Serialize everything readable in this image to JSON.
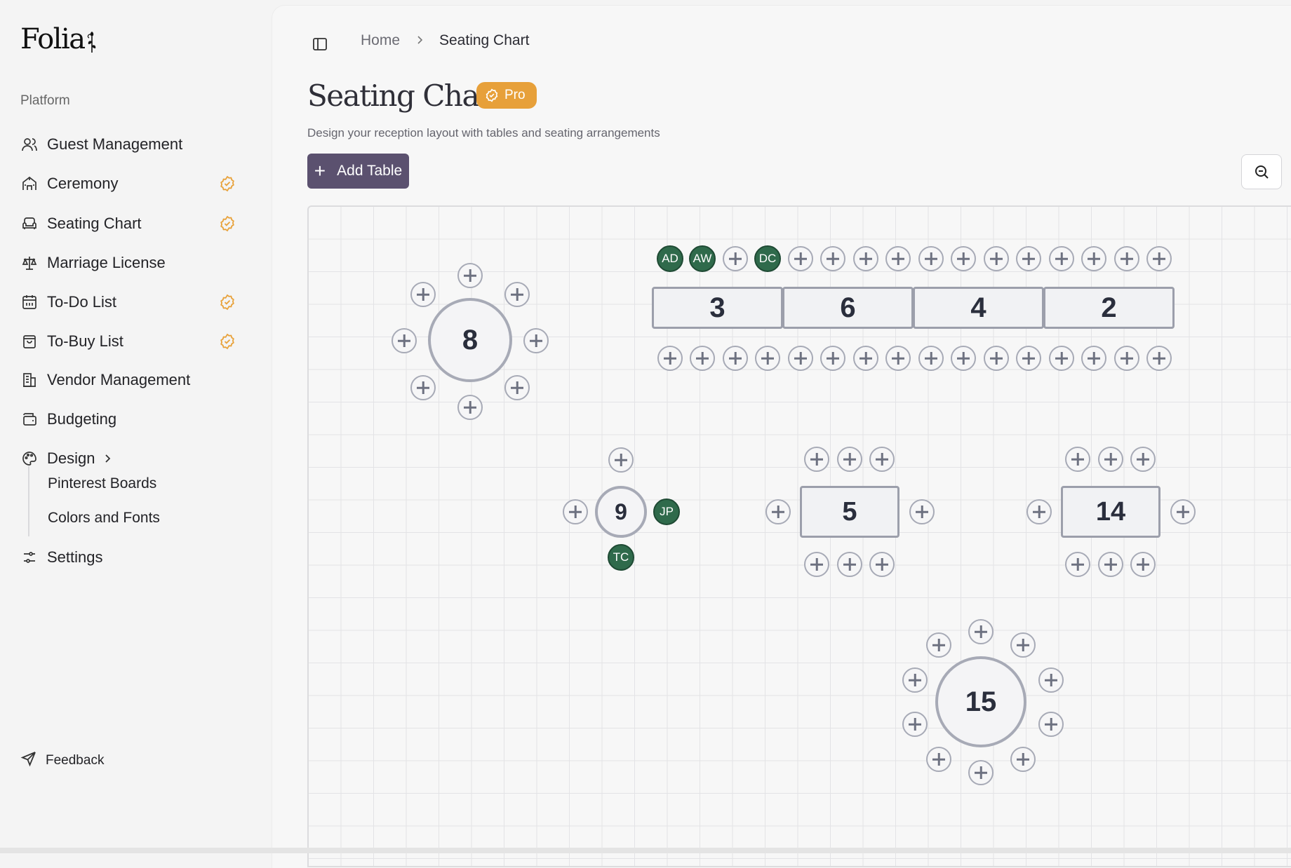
{
  "app": {
    "brand": "Folia"
  },
  "sidebar": {
    "section_label": "Platform",
    "items": [
      {
        "label": "Guest Management",
        "icon": "users-icon",
        "pro": false
      },
      {
        "label": "Ceremony",
        "icon": "chapel-icon",
        "pro": true
      },
      {
        "label": "Seating Chart",
        "icon": "armchair-icon",
        "pro": true
      },
      {
        "label": "Marriage License",
        "icon": "scale-icon",
        "pro": false
      },
      {
        "label": "To-Do List",
        "icon": "calendar-icon",
        "pro": true
      },
      {
        "label": "To-Buy List",
        "icon": "shopping-bag-icon",
        "pro": true
      },
      {
        "label": "Vendor Management",
        "icon": "building-icon",
        "pro": false
      },
      {
        "label": "Budgeting",
        "icon": "wallet-icon",
        "pro": false
      },
      {
        "label": "Design",
        "icon": "palette-icon",
        "pro": false
      }
    ],
    "design_sub": [
      "Pinterest Boards",
      "Colors and Fonts"
    ],
    "settings_label": "Settings",
    "feedback_label": "Feedback",
    "pro_badge_color": "#e8a23b"
  },
  "breadcrumb": {
    "home": "Home",
    "current": "Seating Chart"
  },
  "page": {
    "title": "Seating Chart",
    "pro_label": "Pro",
    "subtitle": "Design your reception layout with tables and seating arrangements",
    "add_table_label": "Add Table"
  },
  "colors": {
    "accent": "#5b516f",
    "pro": "#e7a03a",
    "guest": "#2f6a4b"
  },
  "tables": {
    "round_8": {
      "number": "8"
    },
    "long_segments": [
      "3",
      "6",
      "4",
      "2"
    ],
    "long_top_seats": [
      "AD",
      "AW",
      "",
      "DC",
      "",
      "",
      "",
      "",
      "",
      "",
      "",
      "",
      "",
      "",
      "",
      ""
    ],
    "round_9": {
      "number": "9",
      "guests": [
        "JP",
        "TC"
      ]
    },
    "rect_5": {
      "number": "5"
    },
    "rect_14": {
      "number": "14"
    },
    "round_15": {
      "number": "15"
    }
  }
}
